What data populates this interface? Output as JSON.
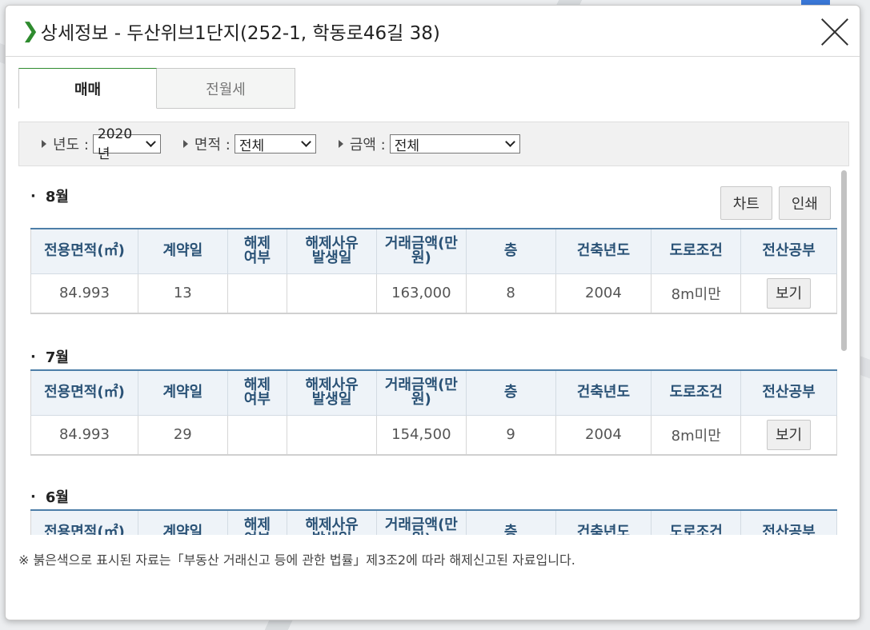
{
  "dialog": {
    "title": "상세정보 - 두산위브1단지(252-1, 학동로46길 38)",
    "close_icon": "close-icon"
  },
  "tabs": [
    {
      "label": "매매",
      "active": true
    },
    {
      "label": "전월세",
      "active": false
    }
  ],
  "filters": {
    "year": {
      "label": "년도 :",
      "value": "2020년"
    },
    "area": {
      "label": "면적 :",
      "value": "전체"
    },
    "price": {
      "label": "금액 :",
      "value": "전체"
    }
  },
  "actions": {
    "chart_label": "차트",
    "print_label": "인쇄"
  },
  "table_headers": [
    "전용면적(㎡)",
    "계약일",
    "해제\n여부",
    "해제사유\n발생일",
    "거래금액(만\n원)",
    "층",
    "건축년도",
    "도로조건",
    "전산공부"
  ],
  "months": [
    {
      "title": "8월",
      "rows": [
        {
          "area": "84.993",
          "contract_day": "13",
          "cancelled": "",
          "cancel_date": "",
          "price": "163,000",
          "floor": "8",
          "built_year": "2004",
          "road": "8m미만",
          "doc_label": "보기"
        }
      ]
    },
    {
      "title": "7월",
      "rows": [
        {
          "area": "84.993",
          "contract_day": "29",
          "cancelled": "",
          "cancel_date": "",
          "price": "154,500",
          "floor": "9",
          "built_year": "2004",
          "road": "8m미만",
          "doc_label": "보기"
        }
      ]
    },
    {
      "title": "6월",
      "rows": []
    }
  ],
  "footnote": "※ 붉은색으로 표시된 자료는「부동산 거래신고 등에 관한 법률」제3조2에 따라 해제신고된 자료입니다.",
  "colors": {
    "accent_green": "#2e8b2e",
    "header_blue": "#4d7ea8",
    "header_text": "#2a5276"
  }
}
